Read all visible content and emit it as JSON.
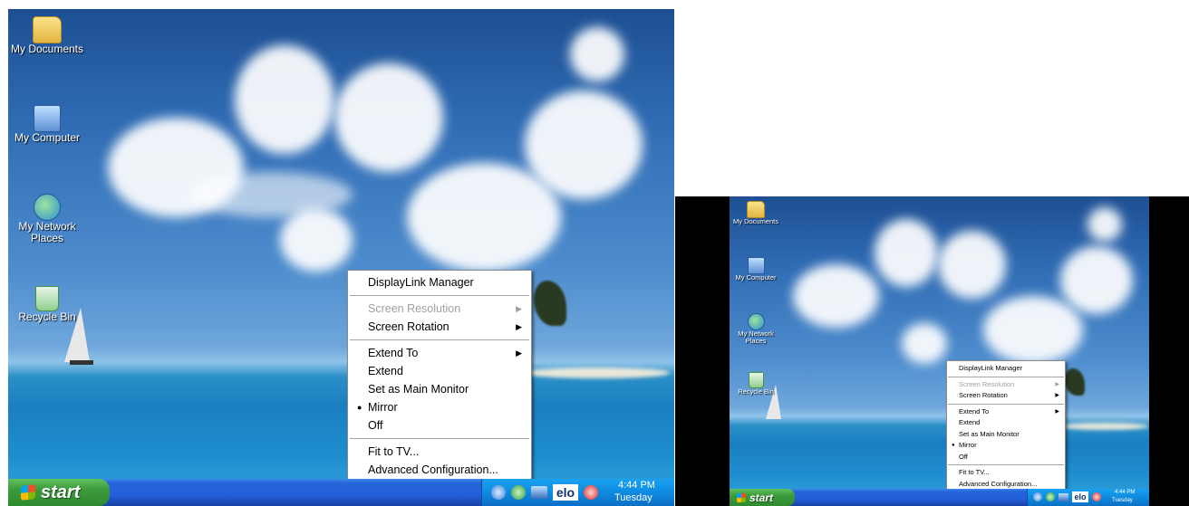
{
  "desktop_icons": [
    {
      "name": "my-documents",
      "label": "My Documents"
    },
    {
      "name": "my-computer",
      "label": "My Computer"
    },
    {
      "name": "my-network-places",
      "label": "My Network Places"
    },
    {
      "name": "recycle-bin",
      "label": "Recycle Bin"
    }
  ],
  "context_menu": {
    "title": "DisplayLink Manager",
    "items": [
      {
        "label": "Screen Resolution",
        "disabled": true,
        "submenu": true
      },
      {
        "label": "Screen Rotation",
        "disabled": false,
        "submenu": true
      },
      {
        "label": "Extend To",
        "disabled": false,
        "submenu": true
      },
      {
        "label": "Extend",
        "disabled": false
      },
      {
        "label": "Set as Main Monitor",
        "disabled": false
      },
      {
        "label": "Mirror",
        "disabled": false,
        "checked": true
      },
      {
        "label": "Off",
        "disabled": false
      },
      {
        "label": "Fit to TV...",
        "disabled": false
      },
      {
        "label": "Advanced Configuration...",
        "disabled": false
      }
    ]
  },
  "taskbar": {
    "start_label": "start",
    "tray_time": "4:44 PM",
    "tray_day": "Tuesday",
    "tray_icons": [
      "back-arrow-icon",
      "network-icon",
      "monitor-icon",
      "elo-icon",
      "security-shield-icon"
    ],
    "elo_text": "elo"
  },
  "colors": {
    "taskbar_blue": "#245edb",
    "start_green": "#3c9a3c",
    "tray_blue": "#0f8be0",
    "menu_bg": "#ffffff",
    "disabled_text": "#a0a0a0"
  }
}
